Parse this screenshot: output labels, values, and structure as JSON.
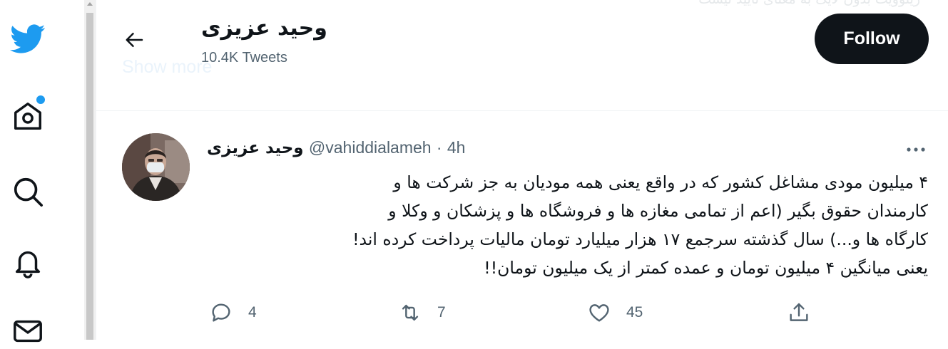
{
  "header": {
    "title": "وحید عزیزی",
    "tweet_count": "10.4K Tweets",
    "follow_label": "Follow",
    "ghost_top_text": "زیتوویت بدون لایک به معنای تایید نیست",
    "ghost_show_more": "Show more"
  },
  "nav": {
    "icons": [
      "twitter-logo-icon",
      "home-icon",
      "search-icon",
      "notifications-icon",
      "messages-icon"
    ],
    "notification_dot_color": "#1d9bf0"
  },
  "tweet": {
    "display_name": "وحید عزیزی",
    "handle": "@vahiddialameh",
    "separator": "·",
    "time": "4h",
    "lines": [
      "۴ میلیون مودی مشاغل کشور که در واقع یعنی همه مودیان به جز شرکت ها و",
      "کارمندان حقوق بگیر (اعم از تمامی مغازه ها و فروشگاه ها و پزشکان و وکلا و",
      "کارگاه ها و...) سال گذشته سرجمع ۱۷ هزار میلیارد تومان مالیات پرداخت کرده اند!",
      "یعنی میانگین ۴ میلیون تومان و عمده کمتر از یک میلیون تومان!!"
    ],
    "replies": "4",
    "retweets": "7",
    "likes": "45"
  },
  "colors": {
    "accent": "#1d9bf0",
    "text": "#0f1419",
    "secondary": "#536471",
    "follow_bg": "#0f1419"
  }
}
